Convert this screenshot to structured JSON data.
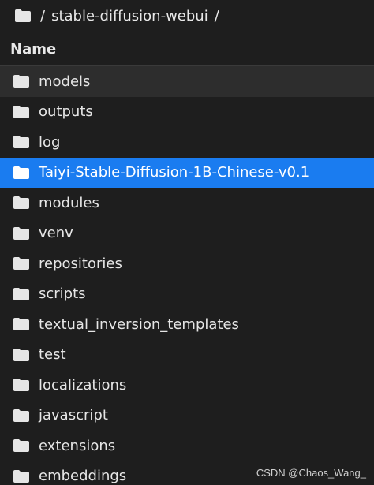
{
  "breadcrumb": {
    "root_sep": "/",
    "folder": "stable-diffusion-webui",
    "trail_sep": "/"
  },
  "header": {
    "name_label": "Name"
  },
  "icons": {
    "breadcrumb": "folder-icon",
    "row": "folder-icon"
  },
  "colors": {
    "selected_row": "#1a7cf0",
    "hover_row": "#2d2d2d",
    "background": "#1e1e1e"
  },
  "rows": [
    {
      "name": "models",
      "state": "hover"
    },
    {
      "name": "outputs",
      "state": ""
    },
    {
      "name": "log",
      "state": ""
    },
    {
      "name": "Taiyi-Stable-Diffusion-1B-Chinese-v0.1",
      "state": "selected"
    },
    {
      "name": "modules",
      "state": ""
    },
    {
      "name": "venv",
      "state": ""
    },
    {
      "name": "repositories",
      "state": ""
    },
    {
      "name": "scripts",
      "state": ""
    },
    {
      "name": "textual_inversion_templates",
      "state": ""
    },
    {
      "name": "test",
      "state": ""
    },
    {
      "name": "localizations",
      "state": ""
    },
    {
      "name": "javascript",
      "state": ""
    },
    {
      "name": "extensions",
      "state": ""
    },
    {
      "name": "embeddings",
      "state": ""
    }
  ],
  "watermark": "CSDN @Chaos_Wang_"
}
